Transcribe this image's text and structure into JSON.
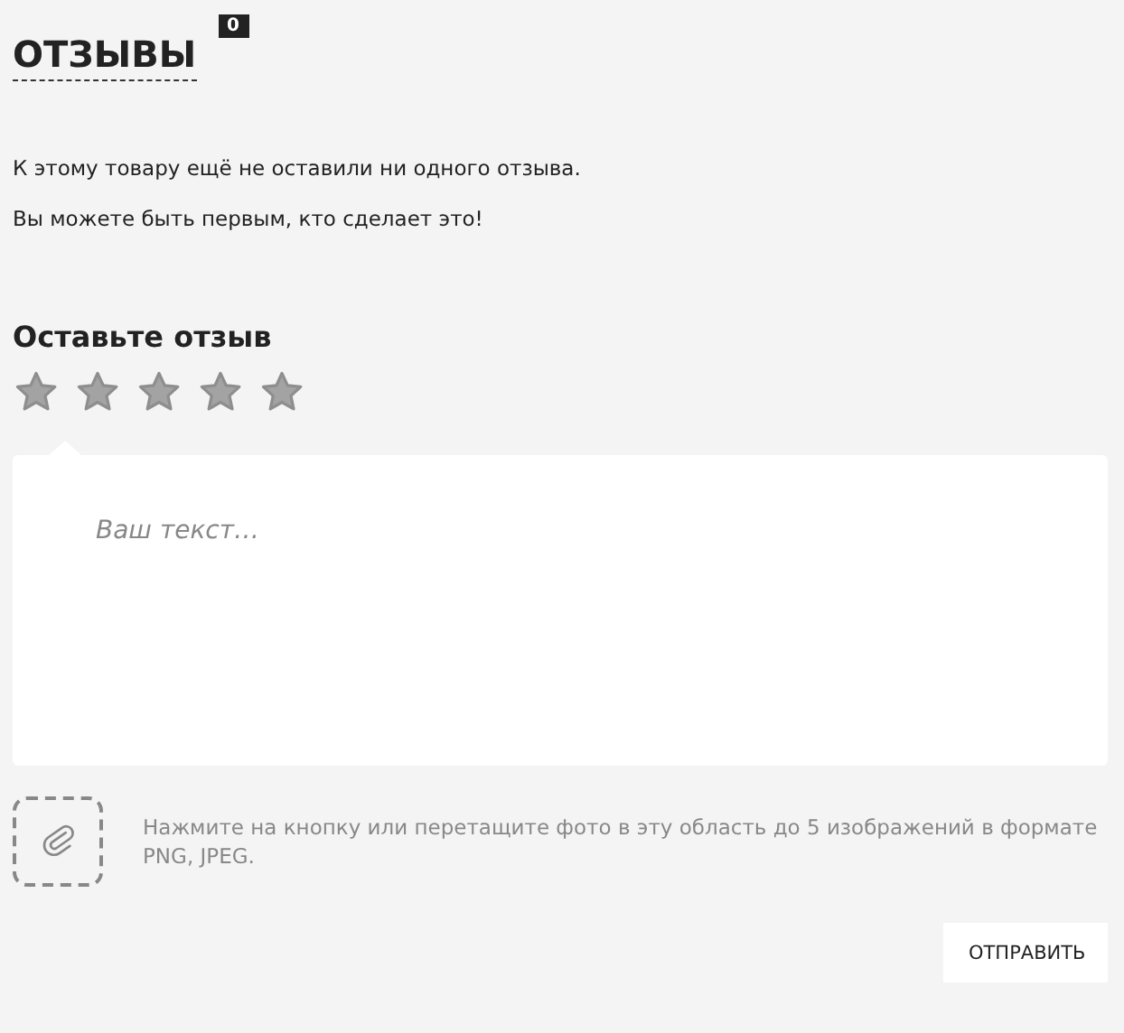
{
  "header": {
    "title": "ОТЗЫВЫ",
    "count": "0"
  },
  "empty_message": [
    "К этому товару ещё не оставили ни одного отзыва.",
    "Вы можете быть первым, кто сделает это!"
  ],
  "form": {
    "heading": "Оставьте отзыв",
    "rating": {
      "stars": 0
    },
    "review": {
      "placeholder": "Ваш текст…"
    },
    "upload_hint": "Нажмите на кнопку или перетащите фото в эту область до 5 изображений в формате PNG, JPEG.",
    "submit": "ОТПРАВИТЬ"
  }
}
